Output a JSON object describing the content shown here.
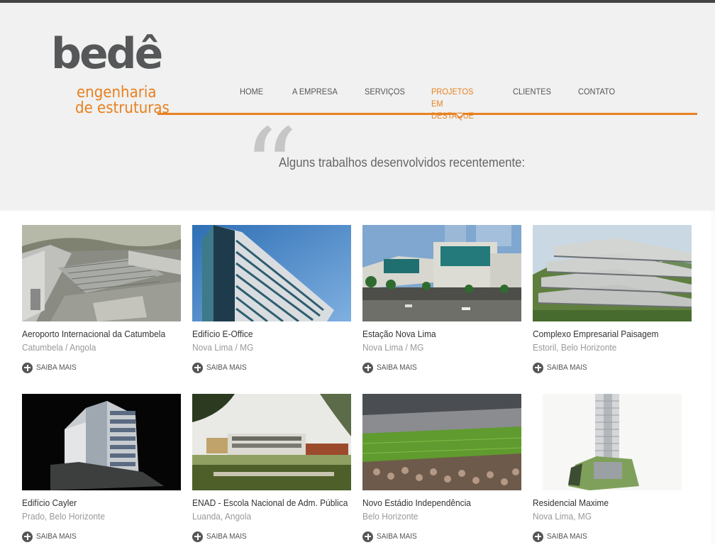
{
  "brand": {
    "name": "bedê",
    "line1": "engenharia",
    "line2": "de estruturas",
    "accent_color": "#e88121",
    "text_color": "#555759"
  },
  "nav": {
    "items": [
      {
        "label": "HOME",
        "active": false
      },
      {
        "label": "A EMPRESA",
        "active": false
      },
      {
        "label": "SERVIÇOS",
        "active": false
      },
      {
        "label": "PROJETOS EM DESTAQUE",
        "active": true
      },
      {
        "label": "CLIENTES",
        "active": false
      },
      {
        "label": "CONTATO",
        "active": false
      }
    ]
  },
  "hero": {
    "quote_glyph": "“",
    "tagline": "Alguns trabalhos desenvolvidos recentemente:"
  },
  "projects": [
    {
      "title": "Aeroporto Internacional da Catumbela",
      "location": "Catumbela / Angola",
      "more": "SAIBA MAIS",
      "image": "airport-construction"
    },
    {
      "title": "Edifício E-Office",
      "location": "Nova Lima / MG",
      "more": "SAIBA MAIS",
      "image": "glass-office-tower"
    },
    {
      "title": "Estação Nova Lima",
      "location": "Nova Lima / MG",
      "more": "SAIBA MAIS",
      "image": "commercial-complex"
    },
    {
      "title": "Complexo Empresarial Paisagem",
      "location": "Estoril, Belo Horizonte",
      "more": "SAIBA MAIS",
      "image": "terraced-building"
    },
    {
      "title": "Edifício Cayler",
      "location": "Prado, Belo Horizonte",
      "more": "SAIBA MAIS",
      "image": "night-office-building"
    },
    {
      "title": "ENAD - Escola Nacional de Adm. Pública",
      "location": "Luanda, Angola",
      "more": "SAIBA MAIS",
      "image": "school-campus"
    },
    {
      "title": "Novo Estádio Independência",
      "location": "Belo Horizonte",
      "more": "SAIBA MAIS",
      "image": "football-stadium"
    },
    {
      "title": "Residencial Maxime",
      "location": "Nova Lima, MG",
      "more": "SAIBA MAIS",
      "image": "residential-tower"
    }
  ]
}
